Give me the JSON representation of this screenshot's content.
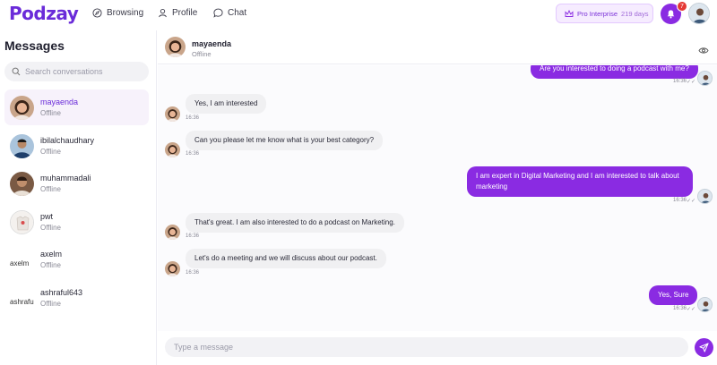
{
  "app": {
    "logo": "Podzay",
    "nav": [
      {
        "label": "Browsing",
        "icon": "compass-icon"
      },
      {
        "label": "Profile",
        "icon": "user-icon"
      },
      {
        "label": "Chat",
        "icon": "chat-bubble-icon"
      }
    ],
    "pro_badge": {
      "label": "Pro Interprise",
      "days": "219 days",
      "icon": "crown-icon"
    },
    "notifications": {
      "count": "7",
      "icon": "bell-icon"
    },
    "colors": {
      "brand": "#6a2bd9",
      "accent": "#8a2be2",
      "badge": "#e53935"
    }
  },
  "sidebar": {
    "title": "Messages",
    "search_placeholder": "Search conversations",
    "conversations": [
      {
        "name": "mayaenda",
        "status": "Offline",
        "active": true
      },
      {
        "name": "ibilalchaudhary",
        "status": "Offline"
      },
      {
        "name": "muhammadali",
        "status": "Offline"
      },
      {
        "name": "pwt",
        "status": "Offline"
      },
      {
        "name": "axelm",
        "status": "Offline",
        "alt": "axelm"
      },
      {
        "name": "ashraful643",
        "status": "Offline",
        "alt": "ashrafu"
      }
    ]
  },
  "chat": {
    "name": "mayaenda",
    "status": "Offline",
    "messages": [
      {
        "dir": "out",
        "text": "Are you interested to doing a podcast with me?",
        "time": "16:36"
      },
      {
        "dir": "in",
        "text": "Yes, I am interested",
        "time": "16:36"
      },
      {
        "dir": "in",
        "text": "Can you please let me know what is your best category?",
        "time": "16:36"
      },
      {
        "dir": "out",
        "text": "I am expert in Digital Marketing and I am interested to talk about marketing",
        "time": "16:36"
      },
      {
        "dir": "in",
        "text": "That's great. I am also interested to do a podcast on Marketing.",
        "time": "16:36"
      },
      {
        "dir": "in",
        "text": "Let's do a meeting and we will discuss about our podcast.",
        "time": "16:36"
      },
      {
        "dir": "out",
        "text": "Yes, Sure",
        "time": "16:36"
      }
    ],
    "composer_placeholder": "Type a message"
  }
}
